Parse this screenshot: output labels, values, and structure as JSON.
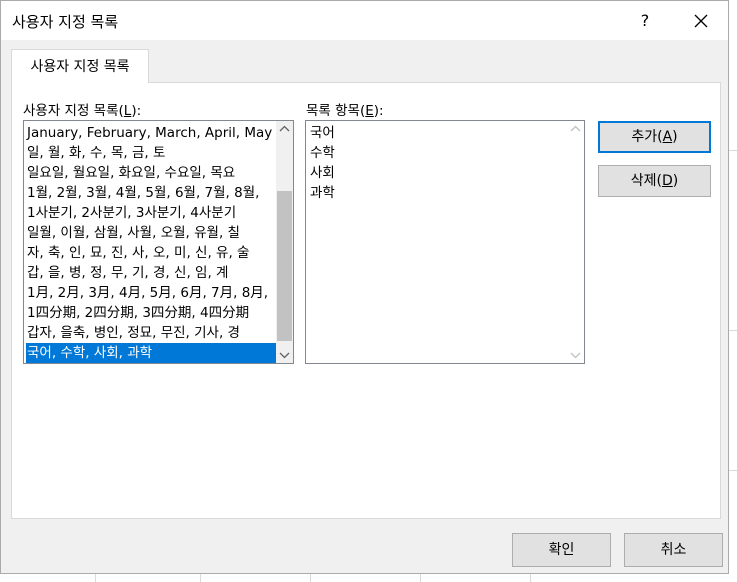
{
  "dialog": {
    "title": "사용자 지정 목록",
    "help_label": "?",
    "tab_label": "사용자 지정 목록"
  },
  "custom_lists": {
    "label_prefix": "사용자 지정 목록(",
    "label_key": "L",
    "label_suffix": "):",
    "items": [
      "January, February, March, April, May",
      "일, 월, 화, 수, 목, 금, 토",
      "일요일, 월요일, 화요일, 수요일, 목요",
      "1월, 2월, 3월, 4월, 5월, 6월, 7월, 8월,",
      "1사분기, 2사분기, 3사분기, 4사분기",
      "일월, 이월, 삼월, 사월, 오월, 유월, 칠",
      "자, 축, 인, 묘, 진, 사, 오, 미, 신, 유, 술",
      "갑, 을, 병, 정, 무, 기, 경, 신, 임, 계",
      "1月, 2月, 3月, 4月, 5月, 6月, 7月, 8月,",
      "1四分期, 2四分期, 3四分期, 4四分期",
      "갑자, 을축, 병인, 정묘, 무진, 기사, 경",
      "국어, 수학, 사회, 과학"
    ],
    "selected_index": 11
  },
  "list_entries": {
    "label_prefix": "목록 항목(",
    "label_key": "E",
    "label_suffix": "):",
    "items": [
      "국어",
      "수학",
      "사회",
      "과학"
    ]
  },
  "buttons": {
    "add_prefix": "추가(",
    "add_key": "A",
    "add_suffix": ")",
    "delete_prefix": "삭제(",
    "delete_key": "D",
    "delete_suffix": ")",
    "ok": "확인",
    "cancel": "취소"
  },
  "colors": {
    "selection": "#0078d7",
    "dialog_bg": "#f0f0f0",
    "button_bg": "#e1e1e1"
  }
}
